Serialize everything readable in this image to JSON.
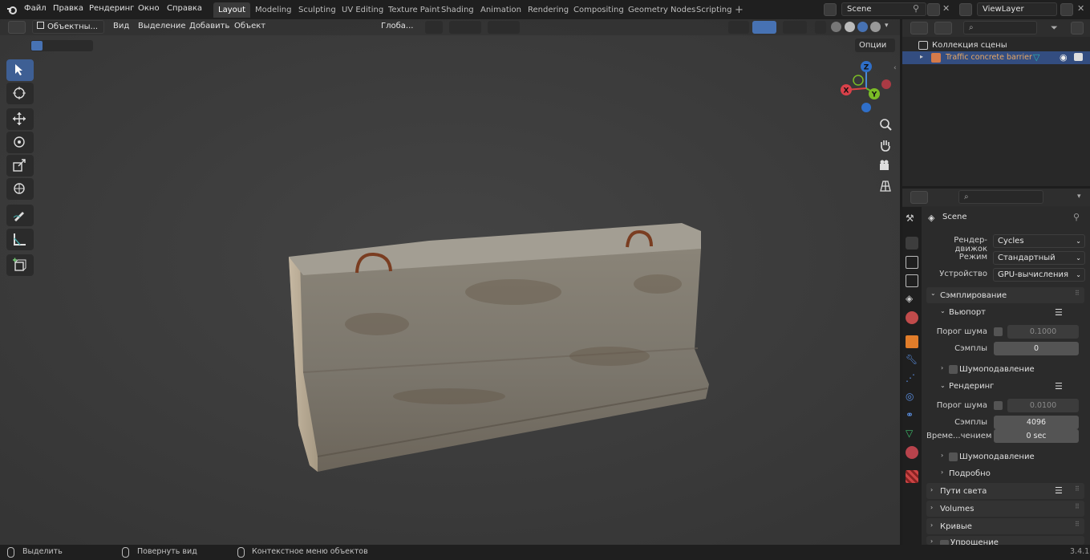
{
  "menu": {
    "items": [
      "Файл",
      "Правка",
      "Рендеринг",
      "Окно",
      "Справка"
    ]
  },
  "workspaces": [
    "Layout",
    "Modeling",
    "Sculpting",
    "UV Editing",
    "Texture Paint",
    "Shading",
    "Animation",
    "Rendering",
    "Compositing",
    "Geometry Nodes",
    "Scripting"
  ],
  "active_workspace": "Layout",
  "scene_name": "Scene",
  "view_layer": "ViewLayer",
  "viewport": {
    "mode": "Объектны...",
    "menus": [
      "Вид",
      "Выделение",
      "Добавить",
      "Объект"
    ],
    "orientation": "Глоба...",
    "options": "Опции",
    "gizmo_axes": [
      "Z",
      "Y",
      "X"
    ]
  },
  "outliner": {
    "collection": "Коллекция сцены",
    "object": "Traffic concrete barrier"
  },
  "properties": {
    "context": "Scene",
    "render_engine_label": "Рендер-движок",
    "render_engine": "Cycles",
    "mode_label": "Режим",
    "mode": "Стандартный",
    "device_label": "Устройство",
    "device": "GPU-вычисления",
    "sampling": "Сэмплирование",
    "viewport_sub": "Вьюпорт",
    "noise_threshold_label": "Порог шума",
    "viewport_noise": "0.1000",
    "samples_label": "Сэмплы",
    "viewport_samples": "0",
    "denoise": "Шумоподавление",
    "render_sub": "Рендеринг",
    "render_noise": "0.0100",
    "render_samples": "4096",
    "time_limit_label": "Време...чением",
    "time_limit": "0 sec",
    "advanced": "Подробно",
    "light_paths": "Пути света",
    "volumes": "Volumes",
    "curves": "Кривые",
    "simplify": "Упрощение"
  },
  "status": {
    "select": "Выделить",
    "rotate": "Повернуть вид",
    "context_menu": "Контекстное меню объектов",
    "version": "3.4.1"
  },
  "colors": {
    "accent": "#4772b3",
    "active_row": "#334d80",
    "object_name": "#e8a864"
  }
}
